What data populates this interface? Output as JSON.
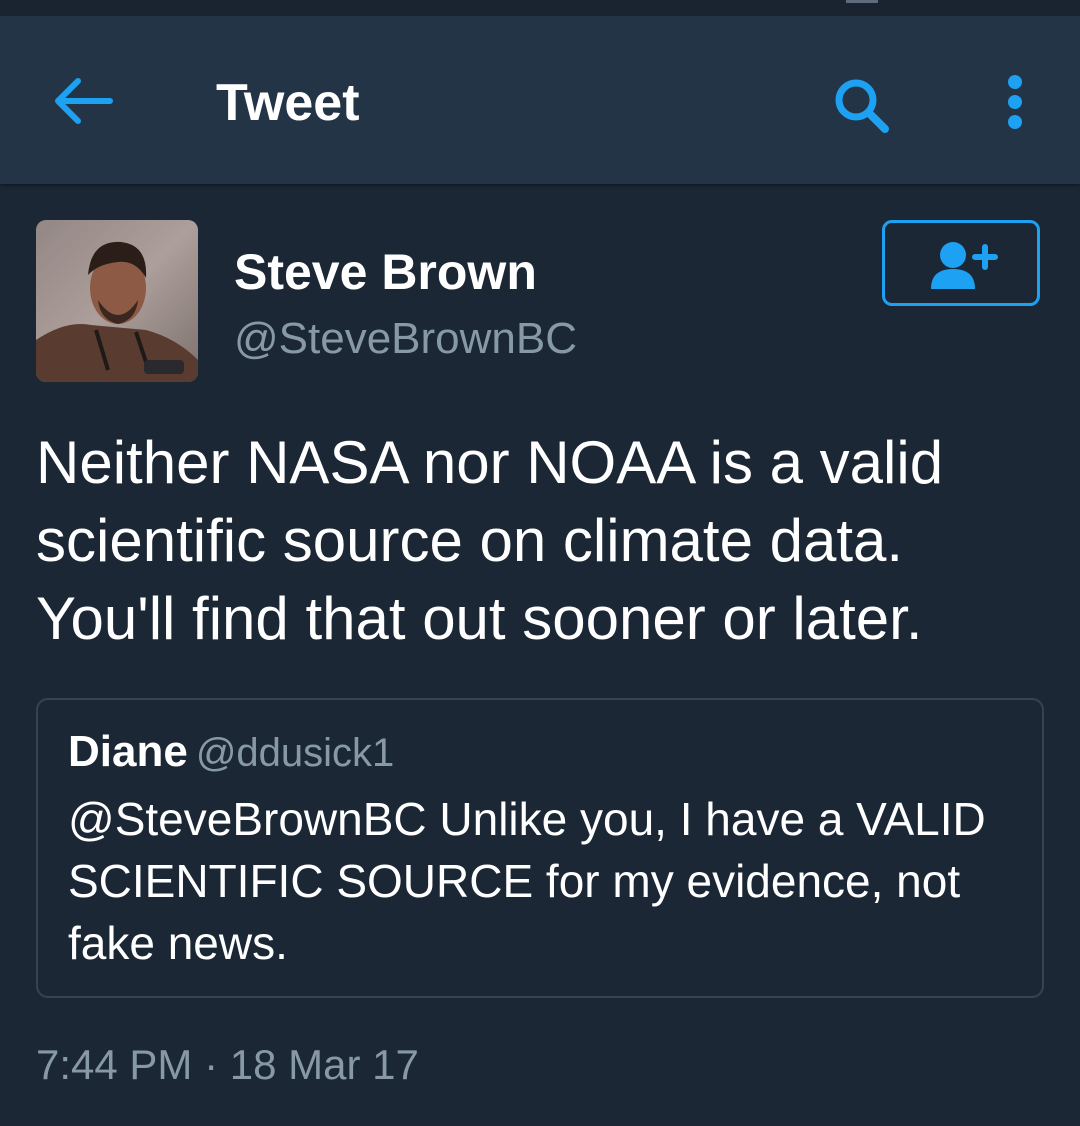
{
  "app_bar": {
    "title": "Tweet",
    "back_icon": "arrow-left-icon",
    "search_icon": "search-icon",
    "more_icon": "more-vertical-icon"
  },
  "tweet": {
    "author": {
      "display_name": "Steve Brown",
      "handle": "@SteveBrownBC",
      "avatar": "profile-photo"
    },
    "follow_icon": "add-user-icon",
    "text": "Neither NASA nor NOAA is a valid scientific source on climate data. You'll find that out sooner or later.",
    "quoted_tweet": {
      "display_name": "Diane",
      "handle": "@ddusick1",
      "text": "@SteveBrownBC Unlike you, I have a VALID SCIENTIFIC SOURCE for my evidence, not fake news."
    },
    "timestamp": "7:44 PM · 18 Mar 17"
  },
  "colors": {
    "background": "#1b2735",
    "app_bar": "#243447",
    "accent": "#1da1f2",
    "secondary_text": "#8899a6",
    "border": "#38444d"
  }
}
